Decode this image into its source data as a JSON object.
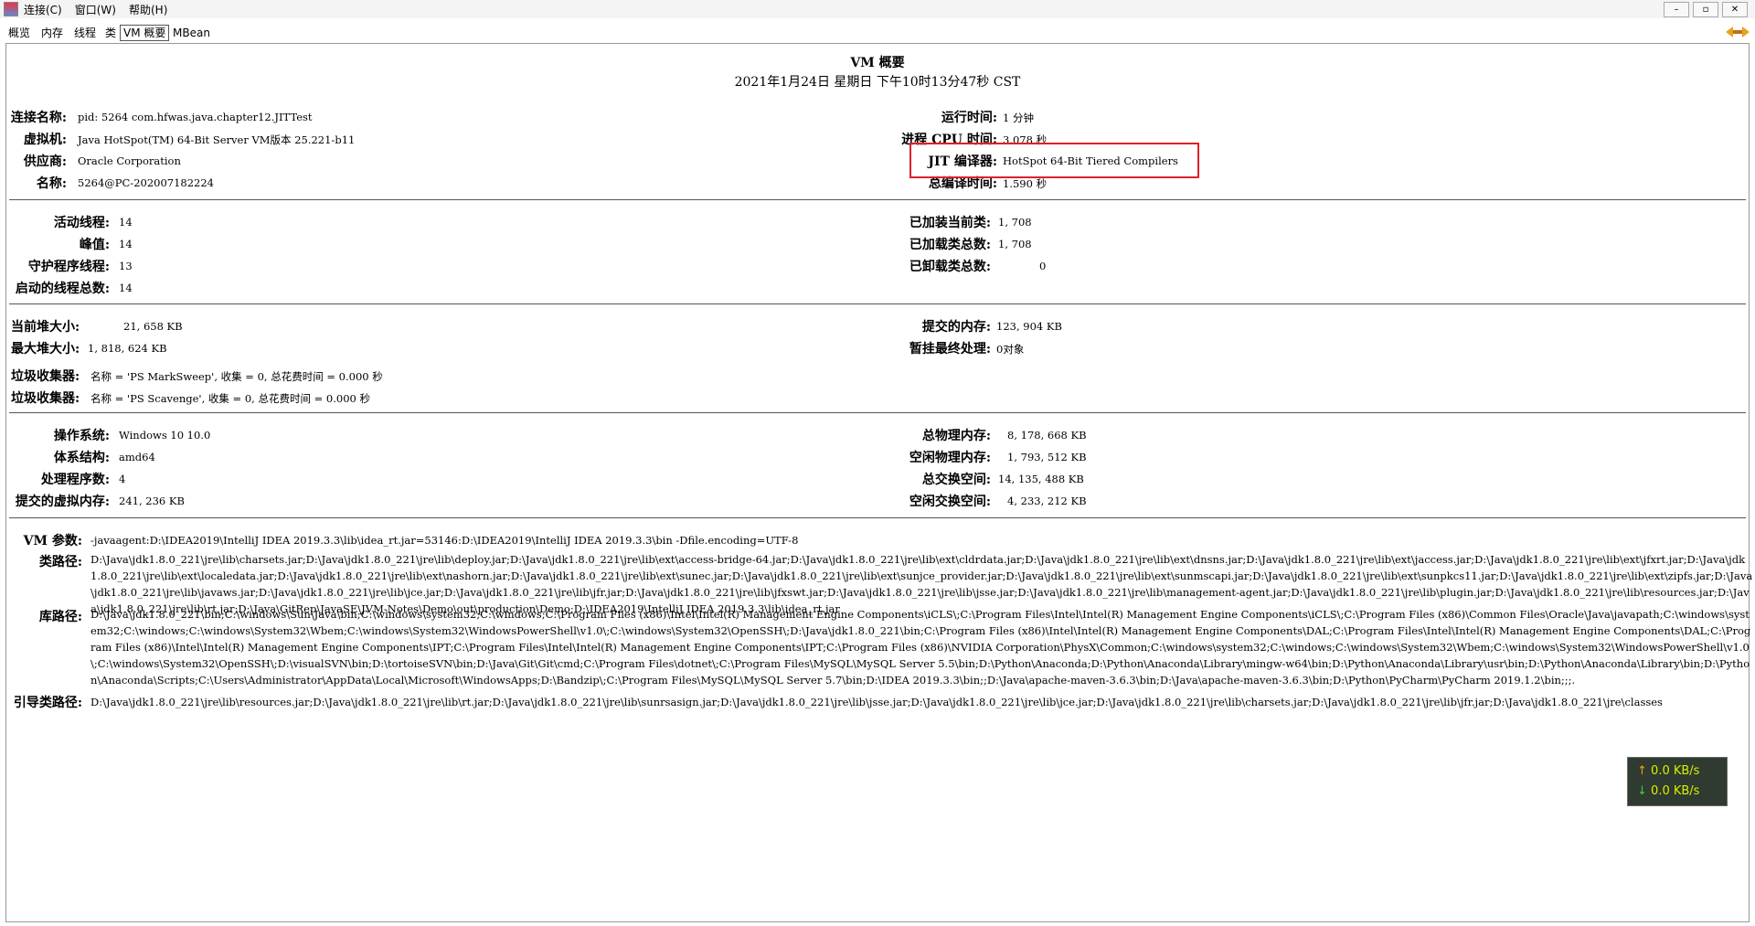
{
  "menubar": {
    "items": [
      "连接(C)",
      "窗口(W)",
      "帮助(H)"
    ],
    "controls": [
      "–",
      "▫",
      "✕"
    ]
  },
  "tabs": [
    "概览",
    "内存",
    "线程",
    "类",
    "VM 概要",
    "MBean"
  ],
  "header": {
    "title": "VM 概要",
    "timestamp": "2021年1月24日 星期日 下午10时13分47秒 CST"
  },
  "vm": {
    "conn_label": "连接名称:",
    "conn_value": "pid: 5264 com.hfwas.java.chapter12.JITTest",
    "vm_label": "虚拟机:",
    "vm_value": "Java HotSpot(TM) 64-Bit Server VM版本 25.221-b11",
    "vendor_label": "供应商:",
    "vendor_value": "Oracle Corporation",
    "name_label": "名称:",
    "name_value": "5264@PC-202007182224",
    "uptime_label": "运行时间:",
    "uptime_value": "1 分钟",
    "cpu_label": "进程 CPU 时间:",
    "cpu_value": "3.078 秒",
    "jit_label": "JIT 编译器:",
    "jit_value": "HotSpot 64-Bit Tiered Compilers",
    "compile_label": "总编译时间:",
    "compile_value": "1.590 秒"
  },
  "threads": {
    "live_label": "活动线程:",
    "live_value": "14",
    "peak_label": "峰值:",
    "peak_value": "14",
    "daemon_label": "守护程序线程:",
    "daemon_value": "13",
    "started_label": "启动的线程总数:",
    "started_value": "14",
    "loaded_label": "已加装当前类:",
    "loaded_value": "1, 708",
    "total_label": "已加载类总数:",
    "total_value": "1, 708",
    "unloaded_label": "已卸载类总数:",
    "unloaded_value": "0"
  },
  "memory": {
    "heap_label": "当前堆大小:",
    "heap_value": "21, 658 KB",
    "maxheap_label": "最大堆大小:",
    "maxheap_value": "1, 818, 624 KB",
    "committed_label": "提交的内存:",
    "committed_value": "123, 904 KB",
    "pending_label": "暂挂最终处理:",
    "pending_value": "0对象",
    "gc1_label": "垃圾收集器:",
    "gc1_value": "名称 = 'PS MarkSweep', 收集 = 0, 总花费时间 = 0.000 秒",
    "gc2_label": "垃圾收集器:",
    "gc2_value": "名称 = 'PS Scavenge', 收集 = 0, 总花费时间 = 0.000 秒"
  },
  "os": {
    "os_label": "操作系统:",
    "os_value": "Windows 10 10.0",
    "arch_label": "体系结构:",
    "arch_value": "amd64",
    "cpus_label": "处理程序数:",
    "cpus_value": "4",
    "vmem_label": "提交的虚拟内存:",
    "vmem_value": "241, 236 KB",
    "phys_label": "总物理内存:",
    "phys_value": "8, 178, 668 KB",
    "freephys_label": "空闲物理内存:",
    "freephys_value": "1, 793, 512 KB",
    "swap_label": "总交换空间:",
    "swap_value": "14, 135, 488 KB",
    "freeswap_label": "空闲交换空间:",
    "freeswap_value": "4, 233, 212 KB"
  },
  "args": {
    "vmargs_label": "VM 参数:",
    "vmargs_value": "-javaagent:D:\\IDEA2019\\IntelliJ IDEA 2019.3.3\\lib\\idea_rt.jar=53146:D:\\IDEA2019\\IntelliJ IDEA 2019.3.3\\bin -Dfile.encoding=UTF-8",
    "classpath_label": "类路径:",
    "classpath_value": "D:\\Java\\jdk1.8.0_221\\jre\\lib\\charsets.jar;D:\\Java\\jdk1.8.0_221\\jre\\lib\\deploy.jar;D:\\Java\\jdk1.8.0_221\\jre\\lib\\ext\\access-bridge-64.jar;D:\\Java\\jdk1.8.0_221\\jre\\lib\\ext\\cldrdata.jar;D:\\Java\\jdk1.8.0_221\\jre\\lib\\ext\\dnsns.jar;D:\\Java\\jdk1.8.0_221\\jre\\lib\\ext\\jaccess.jar;D:\\Java\\jdk1.8.0_221\\jre\\lib\\ext\\jfxrt.jar;D:\\Java\\jdk1.8.0_221\\jre\\lib\\ext\\localedata.jar;D:\\Java\\jdk1.8.0_221\\jre\\lib\\ext\\nashorn.jar;D:\\Java\\jdk1.8.0_221\\jre\\lib\\ext\\sunec.jar;D:\\Java\\jdk1.8.0_221\\jre\\lib\\ext\\sunjce_provider.jar;D:\\Java\\jdk1.8.0_221\\jre\\lib\\ext\\sunmscapi.jar;D:\\Java\\jdk1.8.0_221\\jre\\lib\\ext\\sunpkcs11.jar;D:\\Java\\jdk1.8.0_221\\jre\\lib\\ext\\zipfs.jar;D:\\Java\\jdk1.8.0_221\\jre\\lib\\javaws.jar;D:\\Java\\jdk1.8.0_221\\jre\\lib\\jce.jar;D:\\Java\\jdk1.8.0_221\\jre\\lib\\jfr.jar;D:\\Java\\jdk1.8.0_221\\jre\\lib\\jfxswt.jar;D:\\Java\\jdk1.8.0_221\\jre\\lib\\jsse.jar;D:\\Java\\jdk1.8.0_221\\jre\\lib\\management-agent.jar;D:\\Java\\jdk1.8.0_221\\jre\\lib\\plugin.jar;D:\\Java\\jdk1.8.0_221\\jre\\lib\\resources.jar;D:\\Java\\jdk1.8.0_221\\jre\\lib\\rt.jar;D:\\Java\\GitRep\\JavaSE\\JVM-Notes\\Demo\\out\\production\\Demo;D:\\IDEA2019\\IntelliJ IDEA 2019.3.3\\lib\\idea_rt.jar",
    "libpath_label": "库路径:",
    "libpath_value": "D:\\Java\\jdk1.8.0_221\\bin;C:\\windows\\Sun\\Java\\bin;C:\\windows\\system32;C:\\windows;C:\\Program Files (x86)\\Intel\\Intel(R) Management Engine Components\\iCLS\\;C:\\Program Files\\Intel\\Intel(R) Management Engine Components\\iCLS\\;C:\\Program Files (x86)\\Common Files\\Oracle\\Java\\javapath;C:\\windows\\system32;C:\\windows;C:\\windows\\System32\\Wbem;C:\\windows\\System32\\WindowsPowerShell\\v1.0\\;C:\\windows\\System32\\OpenSSH\\;D:\\Java\\jdk1.8.0_221\\bin;C:\\Program Files (x86)\\Intel\\Intel(R) Management Engine Components\\DAL;C:\\Program Files\\Intel\\Intel(R) Management Engine Components\\DAL;C:\\Program Files (x86)\\Intel\\Intel(R) Management Engine Components\\IPT;C:\\Program Files\\Intel\\Intel(R) Management Engine Components\\IPT;C:\\Program Files (x86)\\NVIDIA Corporation\\PhysX\\Common;C:\\windows\\system32;C:\\windows;C:\\windows\\System32\\Wbem;C:\\windows\\System32\\WindowsPowerShell\\v1.0\\;C:\\windows\\System32\\OpenSSH\\;D:\\visualSVN\\bin;D:\\tortoiseSVN\\bin;D:\\Java\\Git\\Git\\cmd;C:\\Program Files\\dotnet\\;C:\\Program Files\\MySQL\\MySQL Server 5.5\\bin;D:\\Python\\Anaconda;D:\\Python\\Anaconda\\Library\\mingw-w64\\bin;D:\\Python\\Anaconda\\Library\\usr\\bin;D:\\Python\\Anaconda\\Library\\bin;D:\\Python\\Anaconda\\Scripts;C:\\Users\\Administrator\\AppData\\Local\\Microsoft\\WindowsApps;D:\\Bandzip\\;C:\\Program Files\\MySQL\\MySQL Server 5.7\\bin;D:\\IDEA 2019.3.3\\bin;;D:\\Java\\apache-maven-3.6.3\\bin;D:\\Java\\apache-maven-3.6.3\\bin;D:\\Python\\PyCharm\\PyCharm 2019.1.2\\bin;;;.",
    "bootpath_label": "引导类路径:",
    "bootpath_value": "D:\\Java\\jdk1.8.0_221\\jre\\lib\\resources.jar;D:\\Java\\jdk1.8.0_221\\jre\\lib\\rt.jar;D:\\Java\\jdk1.8.0_221\\jre\\lib\\sunrsasign.jar;D:\\Java\\jdk1.8.0_221\\jre\\lib\\jsse.jar;D:\\Java\\jdk1.8.0_221\\jre\\lib\\jce.jar;D:\\Java\\jdk1.8.0_221\\jre\\lib\\charsets.jar;D:\\Java\\jdk1.8.0_221\\jre\\lib\\jfr.jar;D:\\Java\\jdk1.8.0_221\\jre\\classes"
  },
  "netwidget": {
    "up": "0.0 KB/s",
    "down": "0.0 KB/s"
  }
}
